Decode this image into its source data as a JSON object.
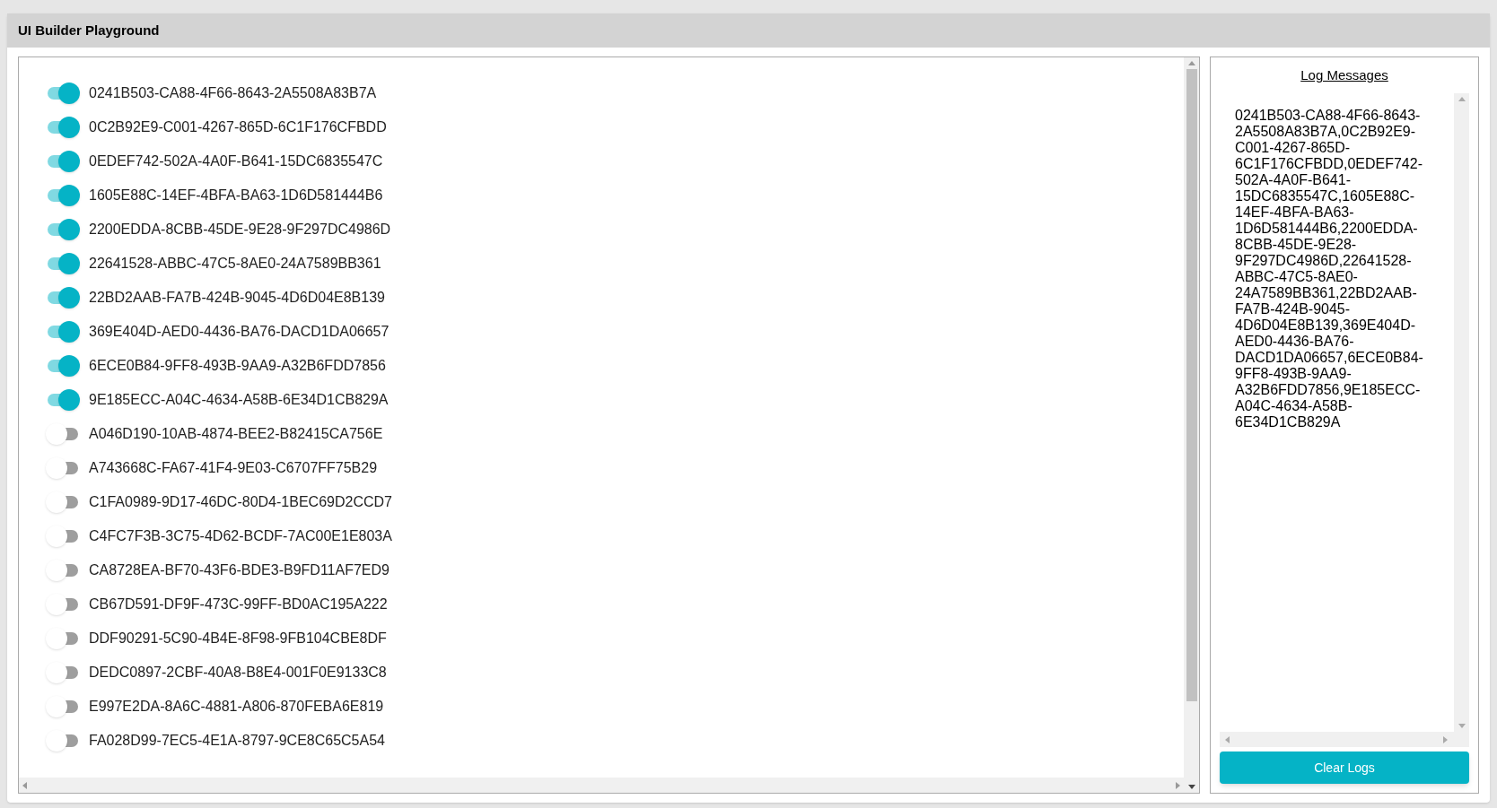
{
  "window": {
    "title": "UI Builder Playground"
  },
  "toggles": [
    {
      "label": "0241B503-CA88-4F66-8643-2A5508A83B7A",
      "on": true
    },
    {
      "label": "0C2B92E9-C001-4267-865D-6C1F176CFBDD",
      "on": true
    },
    {
      "label": "0EDEF742-502A-4A0F-B641-15DC6835547C",
      "on": true
    },
    {
      "label": "1605E88C-14EF-4BFA-BA63-1D6D581444B6",
      "on": true
    },
    {
      "label": "2200EDDA-8CBB-45DE-9E28-9F297DC4986D",
      "on": true
    },
    {
      "label": "22641528-ABBC-47C5-8AE0-24A7589BB361",
      "on": true
    },
    {
      "label": "22BD2AAB-FA7B-424B-9045-4D6D04E8B139",
      "on": true
    },
    {
      "label": "369E404D-AED0-4436-BA76-DACD1DA06657",
      "on": true
    },
    {
      "label": "6ECE0B84-9FF8-493B-9AA9-A32B6FDD7856",
      "on": true
    },
    {
      "label": "9E185ECC-A04C-4634-A58B-6E34D1CB829A",
      "on": true
    },
    {
      "label": "A046D190-10AB-4874-BEE2-B82415CA756E",
      "on": false
    },
    {
      "label": "A743668C-FA67-41F4-9E03-C6707FF75B29",
      "on": false
    },
    {
      "label": "C1FA0989-9D17-46DC-80D4-1BEC69D2CCD7",
      "on": false
    },
    {
      "label": "C4FC7F3B-3C75-4D62-BCDF-7AC00E1E803A",
      "on": false
    },
    {
      "label": "CA8728EA-BF70-43F6-BDE3-B9FD11AF7ED9",
      "on": false
    },
    {
      "label": "CB67D591-DF9F-473C-99FF-BD0AC195A222",
      "on": false
    },
    {
      "label": "DDF90291-5C90-4B4E-8F98-9FB104CBE8DF",
      "on": false
    },
    {
      "label": "DEDC0897-2CBF-40A8-B8E4-001F0E9133C8",
      "on": false
    },
    {
      "label": "E997E2DA-8A6C-4881-A806-870FEBA6E819",
      "on": false
    },
    {
      "label": "FA028D99-7EC5-4E1A-8797-9CE8C65C5A54",
      "on": false
    }
  ],
  "log": {
    "title": "Log Messages",
    "text": "0241B503-CA88-4F66-8643-2A5508A83B7A,0C2B92E9-C001-4267-865D-6C1F176CFBDD,0EDEF742-502A-4A0F-B641-15DC6835547C,1605E88C-14EF-4BFA-BA63-1D6D581444B6,2200EDDA-8CBB-45DE-9E28-9F297DC4986D,22641528-ABBC-47C5-8AE0-24A7589BB361,22BD2AAB-FA7B-424B-9045-4D6D04E8B139,369E404D-AED0-4436-BA76-DACD1DA06657,6ECE0B84-9FF8-493B-9AA9-A32B6FDD7856,9E185ECC-A04C-4634-A58B-6E34D1CB829A",
    "button": "Clear Logs"
  }
}
